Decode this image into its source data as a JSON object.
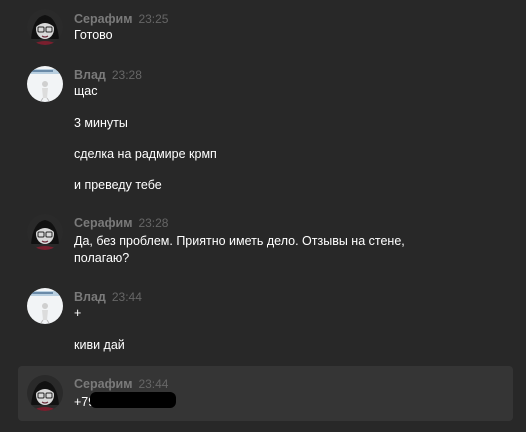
{
  "messages": [
    {
      "author": "Серафим",
      "time": "23:25",
      "lines": [
        "Готово"
      ]
    },
    {
      "author": "Влад",
      "time": "23:28",
      "lines": [
        "щас",
        "3 минуты",
        "сделка на радмире крмп",
        "и преведу тебе"
      ]
    },
    {
      "author": "Серафим",
      "time": "23:28",
      "lines": [
        "Да, без проблем. Приятно иметь дело. Отзывы на стене,",
        "полагаю?"
      ]
    },
    {
      "author": "Влад",
      "time": "23:44",
      "lines": [
        "+",
        "киви дай"
      ]
    },
    {
      "author": "Серафим",
      "time": "23:44",
      "lines": [
        "+79"
      ]
    }
  ],
  "colors": {
    "background": "#282828",
    "highlight": "#353535",
    "author": "#7a7a7a",
    "time": "#666666",
    "text": "#ffffff"
  }
}
